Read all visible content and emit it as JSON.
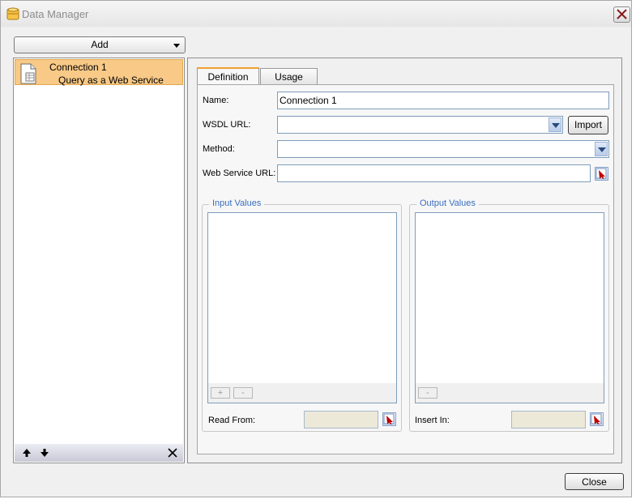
{
  "window": {
    "title": "Data Manager"
  },
  "toolbar": {
    "add_label": "Add"
  },
  "connections": [
    {
      "name": "Connection 1",
      "type": "Query as a Web Service"
    }
  ],
  "tabs": [
    {
      "label": "Definition",
      "active": true
    },
    {
      "label": "Usage",
      "active": false
    }
  ],
  "form": {
    "name_label": "Name:",
    "name_value": "Connection 1",
    "wsdl_label": "WSDL URL:",
    "wsdl_value": "",
    "import_label": "Import",
    "method_label": "Method:",
    "method_value": "",
    "ws_url_label": "Web Service URL:",
    "ws_url_value": ""
  },
  "input_group": {
    "title": "Input Values",
    "add_label": "+",
    "remove_label": "-",
    "read_from_label": "Read From:"
  },
  "output_group": {
    "title": "Output Values",
    "remove_label": "-",
    "insert_in_label": "Insert In:"
  },
  "footer": {
    "close_label": "Close"
  },
  "colors": {
    "selection": "#f8c987",
    "group_title": "#3a6fbf",
    "active_tab_accent": "#f0a030",
    "window_bg": "#f0f0f0"
  },
  "icons": [
    "app-database-icon",
    "close-icon",
    "chevron-down-icon",
    "document-icon",
    "arrow-up-icon",
    "arrow-down-icon",
    "delete-icon",
    "cell-picker-icon"
  ]
}
